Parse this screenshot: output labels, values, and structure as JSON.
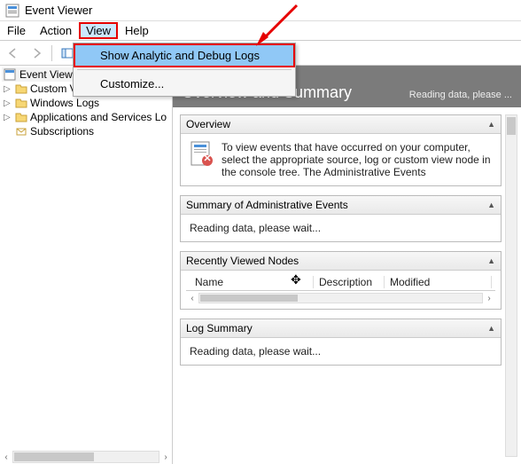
{
  "window": {
    "title": "Event Viewer"
  },
  "menubar": {
    "file": "File",
    "action": "Action",
    "view": "View",
    "help": "Help"
  },
  "dropdown": {
    "show_logs": "Show Analytic and Debug Logs",
    "customize": "Customize..."
  },
  "tree": {
    "root": "Event Viewer",
    "items": [
      "Custom Views",
      "Windows Logs",
      "Applications and Services Lo",
      "Subscriptions"
    ]
  },
  "main": {
    "title": "Overview and Summary",
    "status": "Reading data, please ...",
    "overview": {
      "header": "Overview",
      "text": "To view events that have occurred on your computer, select the appropriate source, log or custom view node in the console tree. The Administrative Events"
    },
    "summary": {
      "header": "Summary of Administrative Events",
      "text": "Reading data, please wait..."
    },
    "recent": {
      "header": "Recently Viewed Nodes",
      "cols": {
        "name": "Name",
        "desc": "Description",
        "mod": "Modified"
      }
    },
    "logsum": {
      "header": "Log Summary",
      "text": "Reading data, please wait..."
    }
  }
}
